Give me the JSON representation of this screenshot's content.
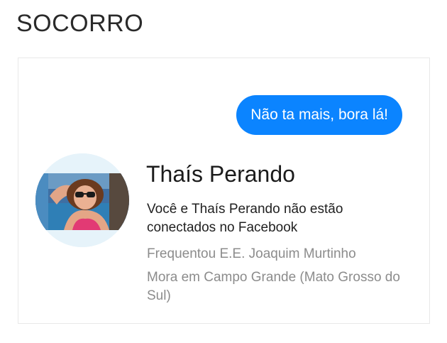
{
  "caption": "SOCORRO",
  "message": {
    "text": "Não ta mais, bora lá!",
    "bubble_color": "#0b84ff"
  },
  "profile": {
    "name": "Thaís Perando",
    "connection_status": "Você e Thaís Perando não estão conectados no Facebook",
    "school": "Frequentou E.E. Joaquim Murtinho",
    "location": "Mora em Campo Grande (Mato Grosso do Sul)"
  }
}
